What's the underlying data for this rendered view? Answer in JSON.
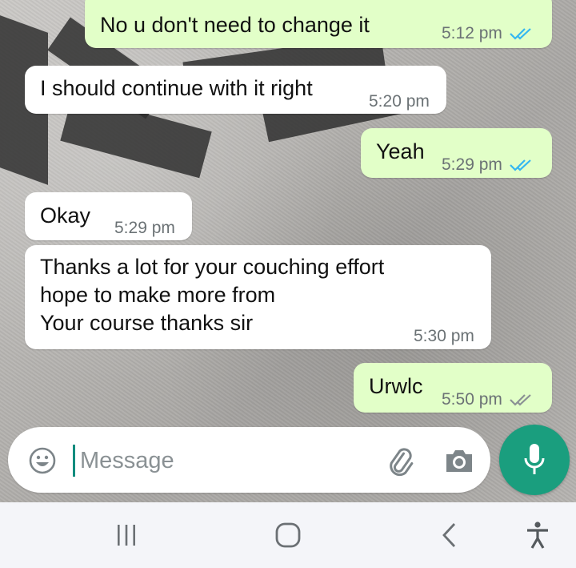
{
  "messages": [
    {
      "id": "m1",
      "direction": "outgoing",
      "lines": [
        "No u don't need to change it"
      ],
      "time": "5:12 pm",
      "status": "read"
    },
    {
      "id": "m2",
      "direction": "incoming",
      "lines": [
        "I should continue with it right"
      ],
      "time": "5:20 pm"
    },
    {
      "id": "m3",
      "direction": "outgoing",
      "lines": [
        "Yeah"
      ],
      "time": "5:29 pm",
      "status": "read"
    },
    {
      "id": "m4",
      "direction": "incoming",
      "lines": [
        "Okay"
      ],
      "time": "5:29 pm"
    },
    {
      "id": "m5",
      "direction": "incoming",
      "lines": [
        "Thanks a lot for your couching effort",
        "hope to make more from",
        "Your course thanks sir"
      ],
      "time": "5:30 pm"
    },
    {
      "id": "m6",
      "direction": "outgoing",
      "lines": [
        "Urwlc"
      ],
      "time": "5:50 pm",
      "status": "delivered"
    }
  ],
  "composer": {
    "placeholder": "Message",
    "value": ""
  },
  "icons": {
    "emoji": "emoji-icon",
    "attach": "paperclip-icon",
    "camera": "camera-icon",
    "mic": "microphone-icon",
    "nav_recents": "recents-icon",
    "nav_home": "home-icon",
    "nav_back": "back-icon",
    "nav_accessibility": "accessibility-icon"
  },
  "colors": {
    "outgoing_bubble": "#e2ffc8",
    "incoming_bubble": "#ffffff",
    "read_ticks": "#34b7f1",
    "delivered_ticks": "#8a9194",
    "mic_button": "#1a9e7e",
    "caret": "#128c7e"
  }
}
